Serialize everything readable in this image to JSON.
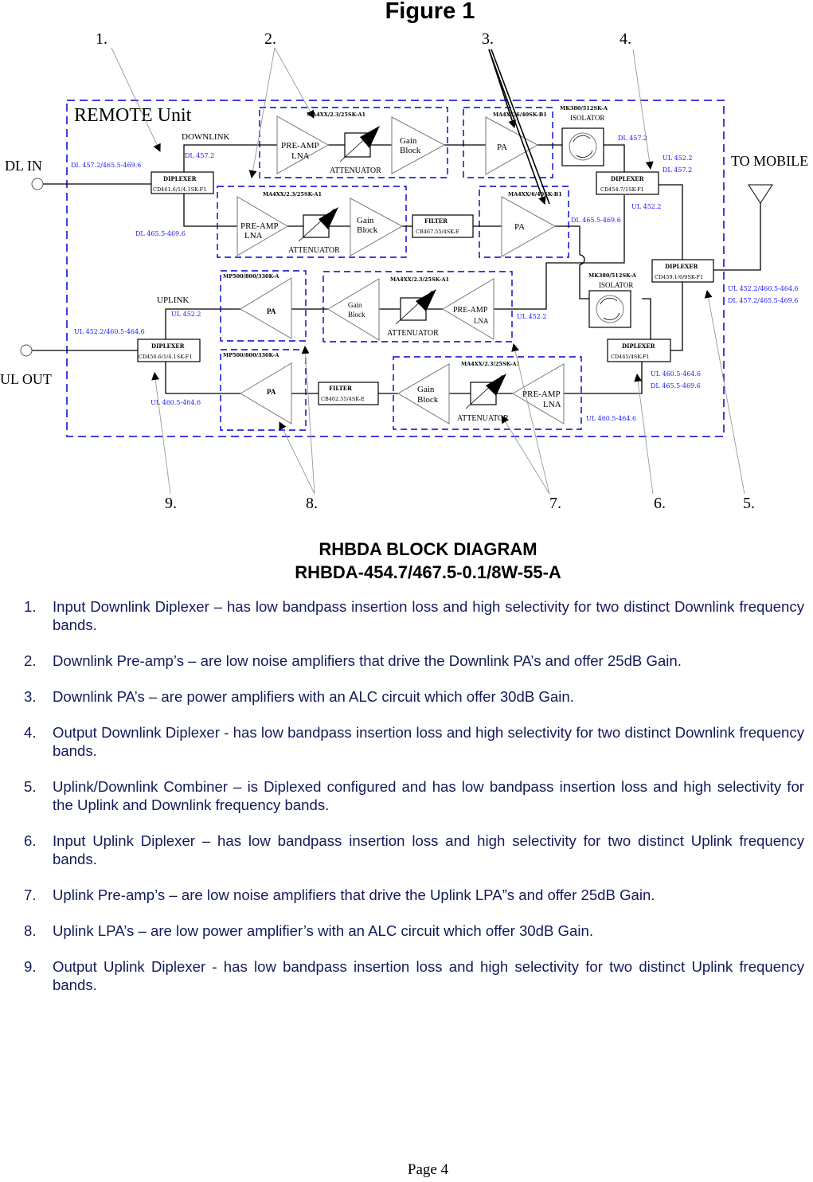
{
  "figure_title": "Figure 1",
  "callout_numbers_top": [
    "1.",
    "2.",
    "3.",
    "4."
  ],
  "callout_numbers_bottom": [
    "9.",
    "8.",
    "7.",
    "6.",
    "5."
  ],
  "diagram": {
    "unit_label": "REMOTE Unit",
    "ports": {
      "dl_in": "DL IN",
      "ul_out": "UL OUT",
      "to_mobile": "TO MOBILE"
    },
    "path_labels": {
      "downlink": "DOWNLINK",
      "uplink": "UPLINK"
    },
    "blocks": {
      "diplexer_label": "DIPLEXER",
      "filter_label": "FILTER",
      "isolator_label": "ISOLATOR",
      "pa_label": "PA",
      "preamp_label": "PRE-AMP",
      "lna_label": "LNA",
      "gain_label": "Gain",
      "block_label": "Block",
      "attenuator_label": "ATTENUATOR"
    },
    "part_numbers": {
      "dl_input_diplexer": "CD461.6/1/4.1SK-F1",
      "dl_preamp_module": "MA4XX/2.3/25SK-A1",
      "dl_pa_module": "MA4XX/6/40SK-B1",
      "isolator": "MK380/512SK-A",
      "dl_output_diplexer": "CD454.7/1SK-F1",
      "dl_filter": "CB467.55/4SK-E",
      "combiner_diplexer": "CD459.1/6/9SK-F1",
      "ul_pa_module": "MP500/800/330K-A",
      "ul_preamp_module": "MA4XX/2.3/25SK-A1",
      "ul_output_diplexer": "CD456.6/1/4.1SK-F1",
      "ul_filter": "CB462.55/4SK-E",
      "ul_input_diplexer": "CD465/4SK-F1"
    },
    "freq_labels": {
      "dl_in_band": "DL 457.2/465.5-469.6",
      "dl_upper_path": "DL 457.2",
      "dl_lower_path": "DL 465.5-469.6",
      "dl_out_upper": "DL 457.2",
      "dl_out_lower": "DL 465.5-469.6",
      "dipl454_ul": "UL 452.2",
      "dipl454_dl": "DL 457.2",
      "dipl454_ul_below": "UL 452.2",
      "mobile_ul": "UL 452.2/460.5-464.6",
      "mobile_dl": "DL 457.2/465.5-469.6",
      "ul_out_band": "UL 452.2/460.5-464.6",
      "ul_upper_path": "UL 452.2",
      "ul_lower_path": "UL 460.5-464.6",
      "ul_mid_upper": "UL 452.2",
      "ul_in_ul": "UL 460.5-464.6",
      "ul_in_dl": "DL 465.5-469.6",
      "ul_mid_lower": "UL 460.5-464.6"
    }
  },
  "caption": {
    "line1": "RHBDA BLOCK DIAGRAM",
    "line2": "RHBDA-454.7/467.5-0.1/8W-55-A"
  },
  "descriptions": [
    {
      "num": "1.",
      "text": "Input Downlink Diplexer – has low bandpass insertion loss and high selectivity for two distinct Downlink frequency bands."
    },
    {
      "num": "2.",
      "text": "Downlink Pre-amp’s – are low noise amplifiers that drive the Downlink PA’s and offer 25dB Gain."
    },
    {
      "num": "3.",
      "text": "Downlink PA’s – are power amplifiers with an ALC circuit which offer 30dB Gain."
    },
    {
      "num": "4.",
      "text": "Output Downlink Diplexer - has low bandpass insertion loss and high selectivity for two distinct Downlink frequency bands."
    },
    {
      "num": "5.",
      "text": "Uplink/Downlink Combiner – is Diplexed configured and has low bandpass insertion loss and high selectivity for the Uplink and Downlink frequency bands."
    },
    {
      "num": "6.",
      "text": "Input Uplink Diplexer – has low bandpass insertion loss and high selectivity for two distinct Uplink frequency bands."
    },
    {
      "num": "7.",
      "text": "Uplink Pre-amp’s – are low noise amplifiers that drive the Uplink LPA”s and offer 25dB Gain."
    },
    {
      "num": "8.",
      "text": "Uplink LPA’s – are low power amplifier’s with an ALC circuit which offer 30dB Gain."
    },
    {
      "num": "9.",
      "text": "Output Uplink Diplexer - has low bandpass insertion loss and high selectivity for two distinct Uplink frequency bands."
    }
  ],
  "page_label": "Page 4",
  "colors": {
    "dashed_border": "#0000cc",
    "freq_label": "#1a1aff",
    "body_text": "#141b5a"
  }
}
